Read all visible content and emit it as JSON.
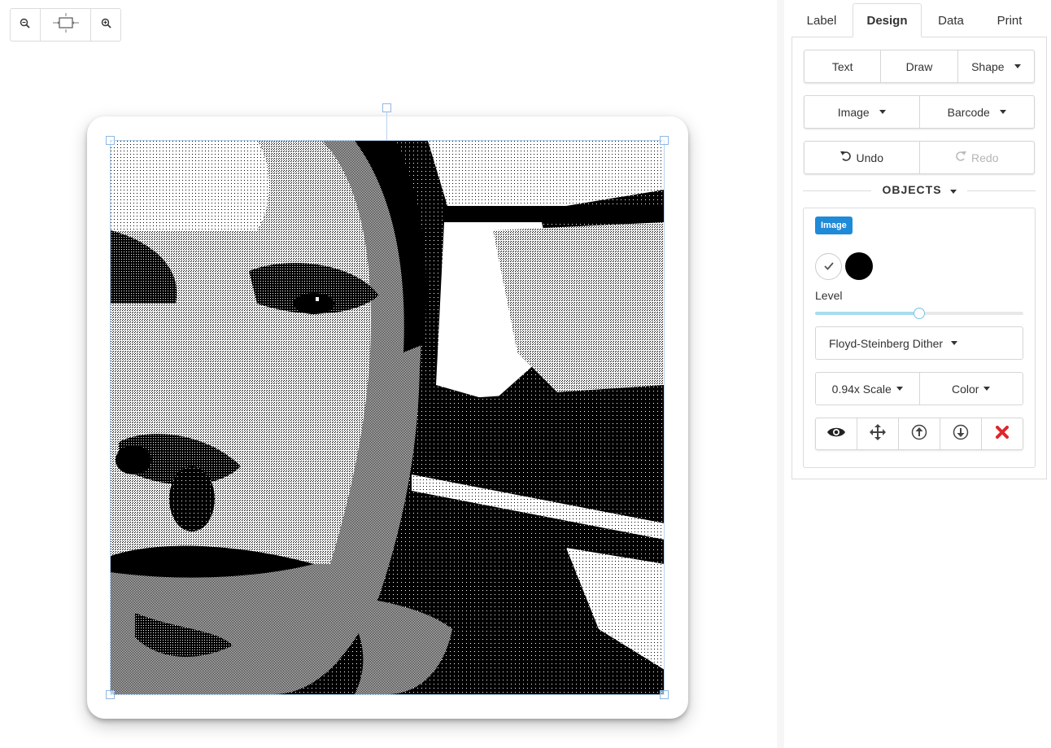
{
  "tabs": [
    {
      "label": "Label",
      "active": false
    },
    {
      "label": "Design",
      "active": true
    },
    {
      "label": "Data",
      "active": false
    },
    {
      "label": "Print",
      "active": false
    }
  ],
  "toolbar": {
    "zoom_out_icon": "zoom-out-icon",
    "fit_icon": "fit-to-screen-icon",
    "zoom_in_icon": "zoom-in-icon"
  },
  "design": {
    "insert_row_1": [
      "Text",
      "Draw",
      "Shape"
    ],
    "insert_row_2": [
      "Image",
      "Barcode"
    ],
    "undo": "Undo",
    "redo": "Redo",
    "objects_title": "OBJECTS"
  },
  "object": {
    "type_badge": "Image",
    "level_label": "Level",
    "level_value": 0.5,
    "dither": "Floyd-Steinberg Dither",
    "scale": "0.94x Scale",
    "color": "Color",
    "accent": "#1f8ad8",
    "actions": [
      "visibility-eye-icon",
      "move-arrows-icon",
      "bring-forward-icon",
      "send-backward-icon",
      "delete-x-icon"
    ]
  }
}
